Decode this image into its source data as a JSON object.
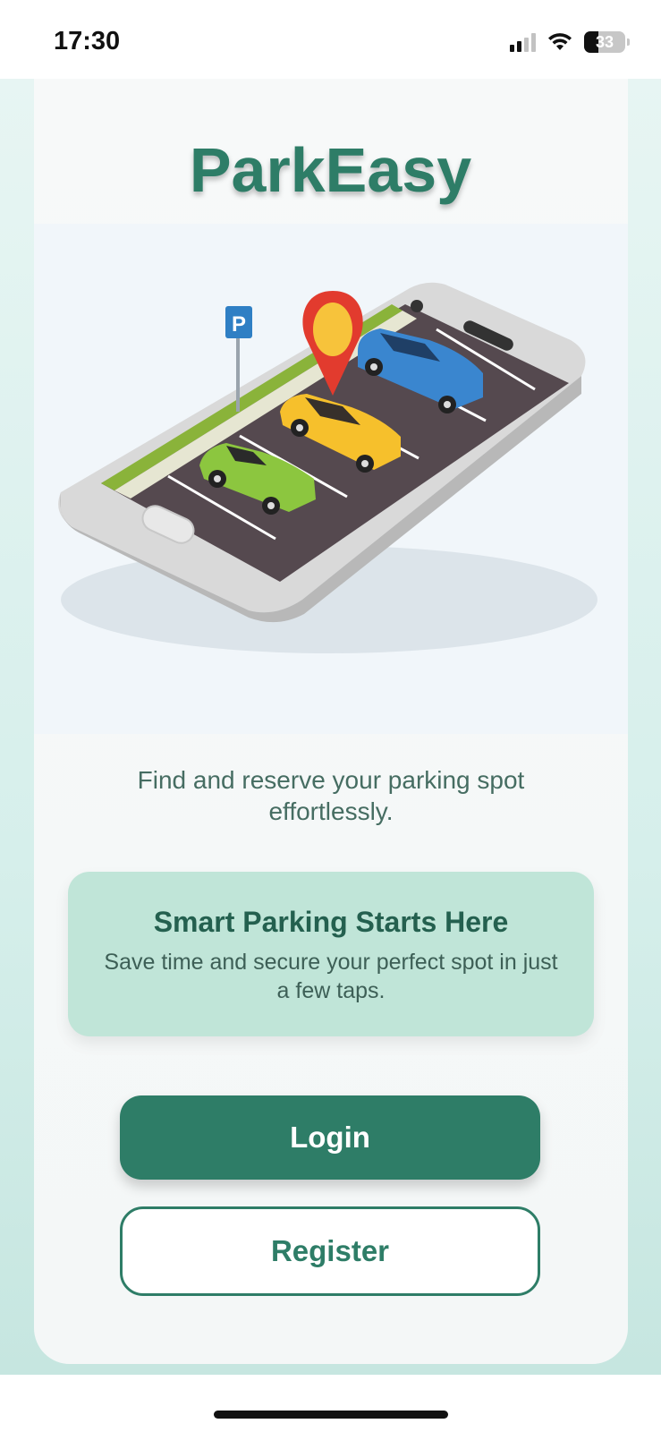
{
  "status_bar": {
    "time": "17:30",
    "battery": "33",
    "icons": [
      "cellular-signal-icon",
      "wifi-icon",
      "battery-icon"
    ]
  },
  "app": {
    "name": "ParkEasy",
    "tagline": "Find and reserve your parking spot effortlessly.",
    "hero_icon": "phone-parking-illustration",
    "parking_sign": "P"
  },
  "info_card": {
    "title": "Smart Parking Starts Here",
    "text": "Save time and secure your perfect spot in just a few taps."
  },
  "buttons": {
    "login": "Login",
    "register": "Register"
  },
  "colors": {
    "brand": "#2e7d67",
    "card_accent": "#c0e5d8",
    "text_muted": "#466d62"
  }
}
